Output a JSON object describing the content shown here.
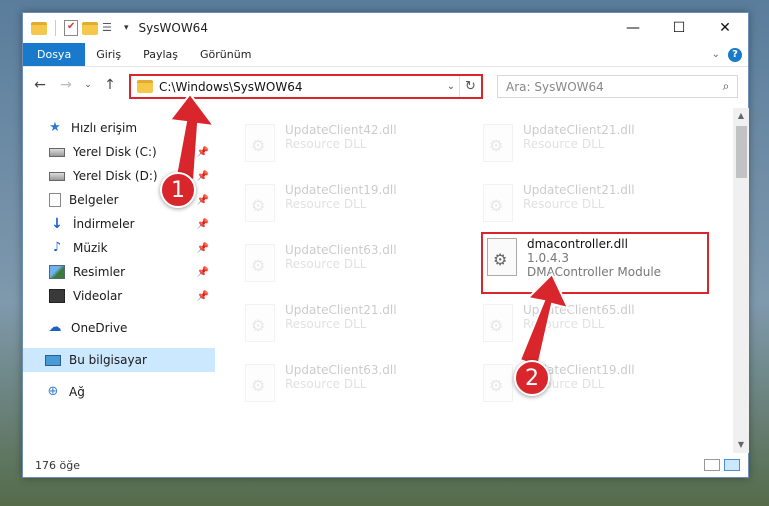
{
  "window": {
    "title": "SysWOW64"
  },
  "ribbon": {
    "file_tab": "Dosya",
    "tabs": [
      "Giriş",
      "Paylaş",
      "Görünüm"
    ]
  },
  "address": {
    "path": "C:\\Windows\\SysWOW64",
    "search_placeholder": "Ara: SysWOW64"
  },
  "nav": {
    "items": [
      {
        "label": "Hızlı erişim",
        "icon": "star-icon"
      },
      {
        "label": "Yerel Disk (C:)",
        "icon": "drive-icon",
        "pinned": true
      },
      {
        "label": "Yerel Disk (D:)",
        "icon": "drive-icon",
        "pinned": true
      },
      {
        "label": "Belgeler",
        "icon": "documents-icon",
        "pinned": true
      },
      {
        "label": "İndirmeler",
        "icon": "download-icon",
        "pinned": true
      },
      {
        "label": "Müzik",
        "icon": "music-icon",
        "pinned": true
      },
      {
        "label": "Resimler",
        "icon": "pictures-icon",
        "pinned": true
      },
      {
        "label": "Videolar",
        "icon": "videos-icon",
        "pinned": true
      },
      {
        "label": "OneDrive",
        "icon": "onedrive-icon"
      },
      {
        "label": "Bu bilgisayar",
        "icon": "this-pc-icon",
        "selected": true
      },
      {
        "label": "Ağ",
        "icon": "network-icon"
      }
    ]
  },
  "files": [
    {
      "name": "UpdateClient42.dll",
      "type": "Resource DLL",
      "faded": true
    },
    {
      "name": "UpdateClient21.dll",
      "type": "Resource DLL",
      "faded": true
    },
    {
      "name": "UpdateClient19.dll",
      "type": "Resource DLL",
      "faded": true
    },
    {
      "name": "UpdateClient21.dll",
      "type": "Resource DLL",
      "faded": true
    },
    {
      "name": "UpdateClient63.dll",
      "type": "Resource DLL",
      "faded": true
    },
    {
      "name": "dmacontroller.dll",
      "version": "1.0.4.3",
      "type": "DMAController Module",
      "faded": false,
      "highlight": true
    },
    {
      "name": "UpdateClient21.dll",
      "type": "Resource DLL",
      "faded": true
    },
    {
      "name": "UpdateClient65.dll",
      "type": "Resource DLL",
      "faded": true
    },
    {
      "name": "UpdateClient63.dll",
      "type": "Resource DLL",
      "faded": true
    },
    {
      "name": "UpdateClient19.dll",
      "type": "Resource DLL",
      "faded": true
    }
  ],
  "status": {
    "item_count": "176 öğe"
  },
  "callouts": {
    "one": "1",
    "two": "2"
  },
  "colors": {
    "accent": "#1979ca",
    "highlight": "#d9262c"
  }
}
